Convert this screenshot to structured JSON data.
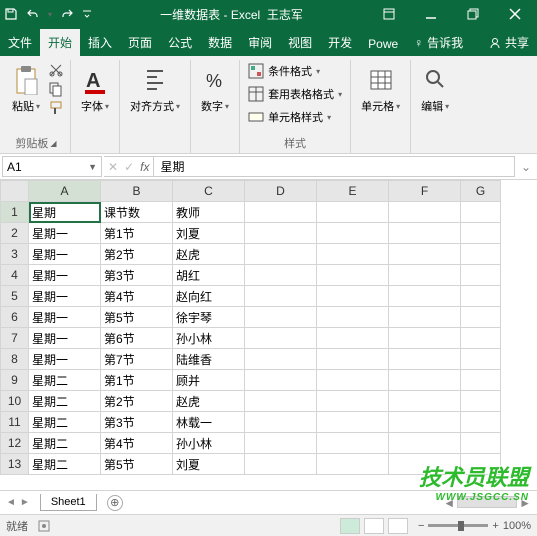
{
  "title": "一维数据表 - Excel",
  "user": "王志军",
  "qat_icons": [
    "save-icon",
    "undo-icon",
    "redo-icon",
    "more-icon"
  ],
  "win_controls": [
    "minimize",
    "restore",
    "close"
  ],
  "tabs": {
    "file": "文件",
    "home": "开始",
    "insert": "插入",
    "layout": "页面",
    "formulas": "公式",
    "data": "数据",
    "review": "审阅",
    "view": "视图",
    "developer": "开发",
    "power": "Powe",
    "tellme": "告诉我",
    "share": "共享"
  },
  "ribbon": {
    "paste": "粘贴",
    "clipboard": "剪贴板",
    "font": "字体",
    "alignment": "对齐方式",
    "number": "数字",
    "cond_format": "条件格式",
    "table_format": "套用表格格式",
    "cell_style": "单元格样式",
    "styles": "样式",
    "cells": "单元格",
    "editing": "编辑"
  },
  "formula_bar": {
    "name_box": "A1",
    "fx": "fx",
    "value": "星期"
  },
  "columns": [
    "A",
    "B",
    "C",
    "D",
    "E",
    "F",
    "G"
  ],
  "chart_data": {
    "type": "table",
    "headers": [
      "星期",
      "课节数",
      "教师"
    ],
    "rows": [
      [
        "星期一",
        "第1节",
        "刘夏"
      ],
      [
        "星期一",
        "第2节",
        "赵虎"
      ],
      [
        "星期一",
        "第3节",
        "胡红"
      ],
      [
        "星期一",
        "第4节",
        "赵向红"
      ],
      [
        "星期一",
        "第5节",
        "徐宇琴"
      ],
      [
        "星期一",
        "第6节",
        "孙小林"
      ],
      [
        "星期一",
        "第7节",
        "陆维香"
      ],
      [
        "星期二",
        "第1节",
        "顾并"
      ],
      [
        "星期二",
        "第2节",
        "赵虎"
      ],
      [
        "星期二",
        "第3节",
        "林载一"
      ],
      [
        "星期二",
        "第4节",
        "孙小林"
      ],
      [
        "星期二",
        "第5节",
        "刘夏"
      ]
    ]
  },
  "sheets": {
    "sheet1": "Sheet1"
  },
  "status": {
    "ready": "就绪",
    "zoom": "100%"
  },
  "watermark": {
    "main": "技术员联盟",
    "sub": "WWW.JSGCC.SN"
  }
}
